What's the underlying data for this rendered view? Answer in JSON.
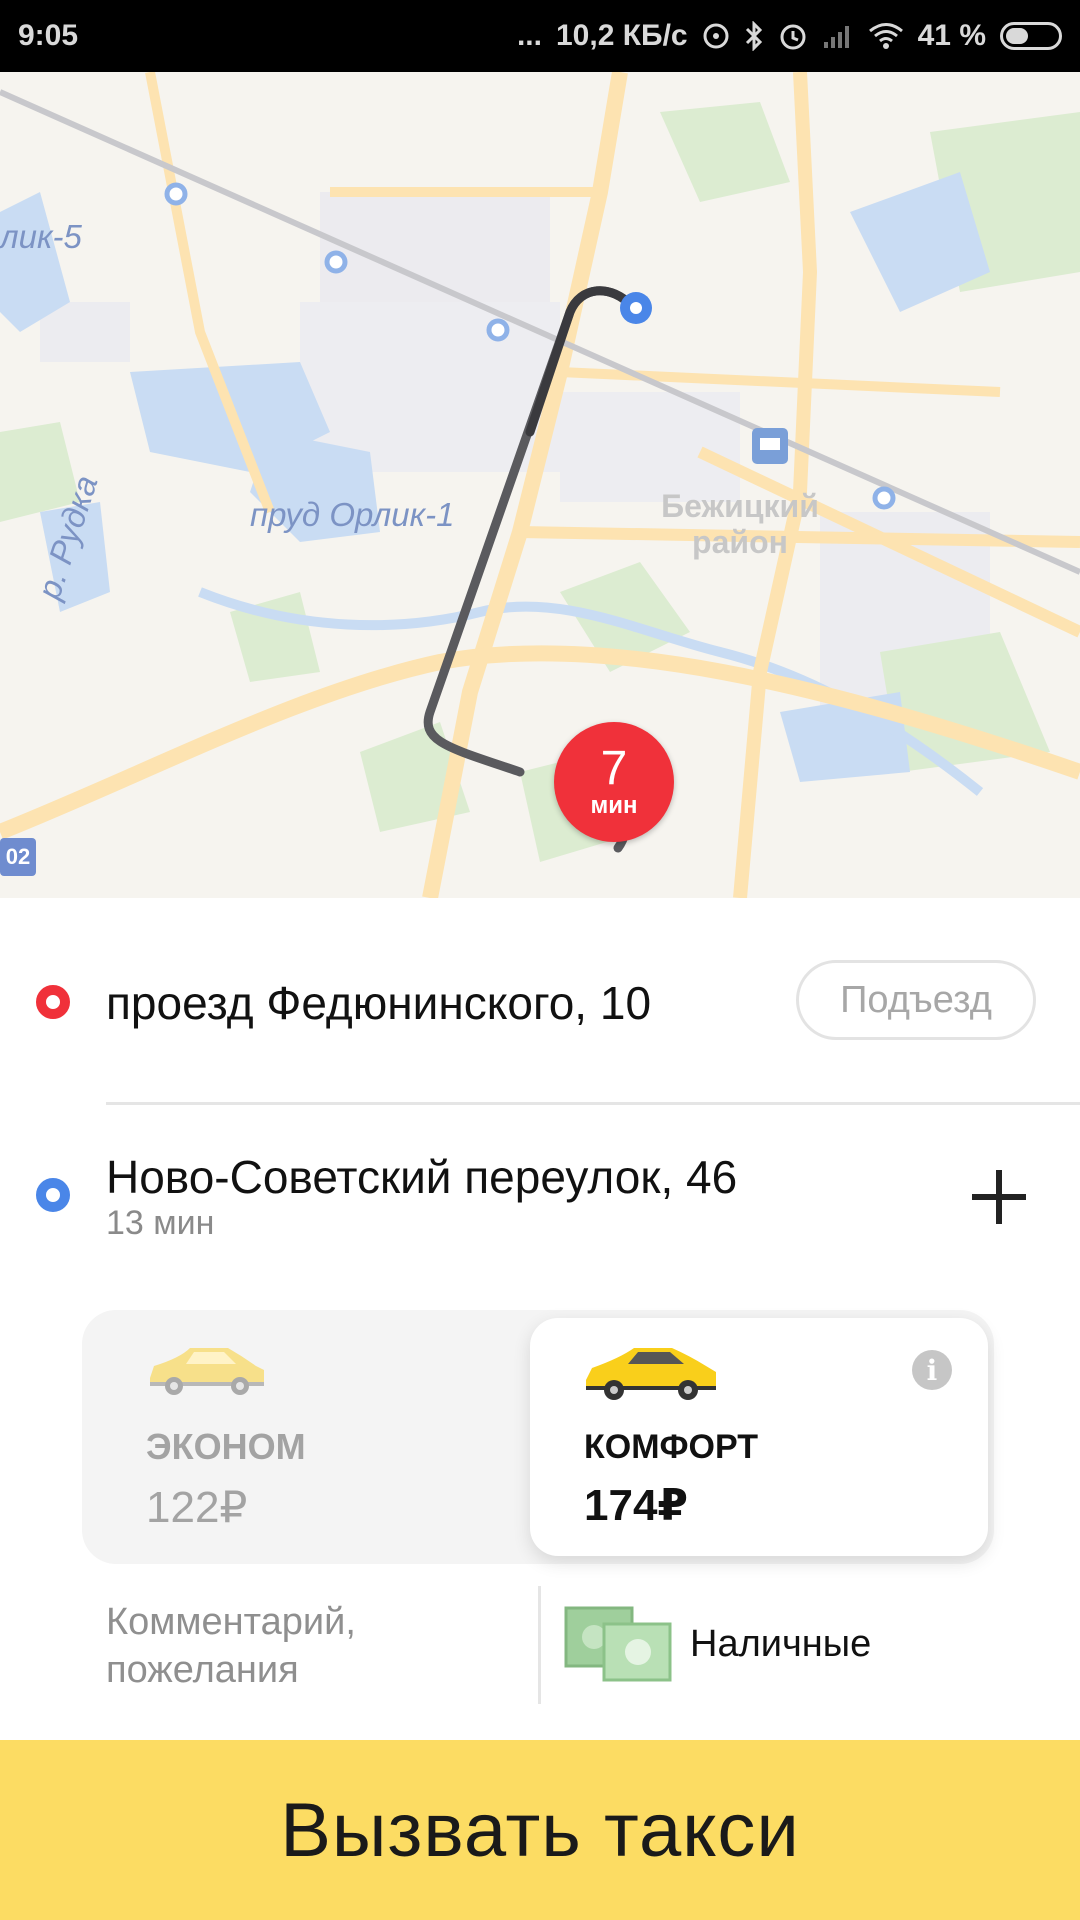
{
  "status_bar": {
    "time": "9:05",
    "dots": "...",
    "network_speed": "10,2 КБ/с",
    "battery_percent": "41 %",
    "icons": [
      "hotspot-icon",
      "bluetooth-icon",
      "alarm-icon",
      "signal-icon",
      "wifi-icon",
      "battery-icon"
    ]
  },
  "map": {
    "eta_value": "7",
    "eta_unit": "мин",
    "labels": {
      "orlik5": "лик-5",
      "pond": "пруд Орлик-1",
      "river": "р. Рудка",
      "district_line1": "Бежицкий",
      "district_line2": "район",
      "road_number": "02"
    },
    "colors": {
      "route": "#5a5a5e",
      "pickup_pin": "#f0313a",
      "destination_pin": "#4a86e8",
      "water": "#c9dcf3",
      "park": "#dcecd1",
      "road": "#fde3b1"
    }
  },
  "route": {
    "pickup_address": "проезд Федюнинского, 10",
    "entrance_button": "Подъезд",
    "destination_address": "Ново-Советский переулок, 46",
    "destination_time": "13 мин"
  },
  "tariffs": [
    {
      "name": "ЭКОНОМ",
      "price": "122₽",
      "selected": false
    },
    {
      "name": "КОМФОРТ",
      "price": "174₽",
      "selected": true
    }
  ],
  "options": {
    "comment_placeholder_line1": "Комментарий,",
    "comment_placeholder_line2": "пожелания",
    "payment_method": "Наличные"
  },
  "call_button": "Вызвать такси",
  "info_icon_glyph": "i"
}
